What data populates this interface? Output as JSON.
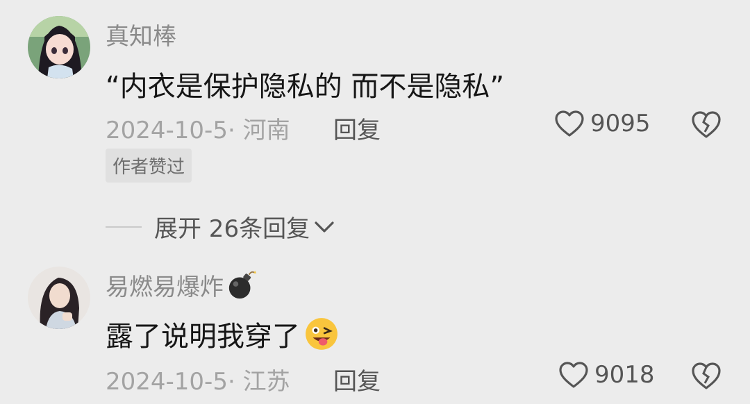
{
  "comments": [
    {
      "username": "真知棒",
      "text": "“内衣是保护隐私的 而不是隐私”",
      "date_location": "2024-10-5· 河南",
      "reply_label": "回复",
      "like_count": "9095",
      "badge": "作者赞过",
      "expand_label": "展开 26条回复",
      "avatar_icon": "anime-girl-avatar"
    },
    {
      "username": "易燃易爆炸",
      "username_icon": "bomb-icon",
      "text": "露了说明我穿了",
      "text_icon": "winking-tongue-emoji",
      "date_location": "2024-10-5· 江苏",
      "reply_label": "回复",
      "like_count": "9018",
      "avatar_icon": "girl-photo-avatar"
    }
  ],
  "colors": {
    "background": "#ececec",
    "username": "#8a8a8a",
    "text": "#161616",
    "meta": "#a3a3a3"
  }
}
